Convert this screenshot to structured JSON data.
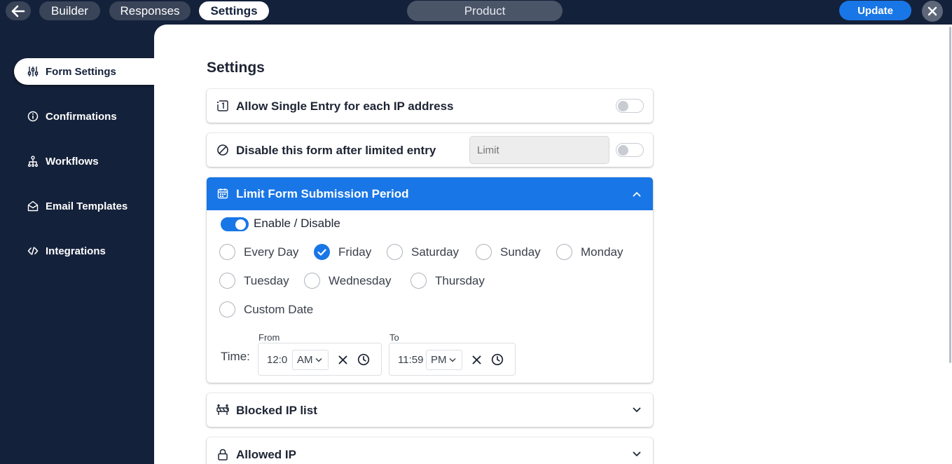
{
  "topbar": {
    "tabs": [
      {
        "label": "Builder",
        "active": false
      },
      {
        "label": "Responses",
        "active": false
      },
      {
        "label": "Settings",
        "active": true
      }
    ],
    "form_name": "Product",
    "update_label": "Update"
  },
  "sidebar": {
    "items": [
      {
        "label": "Form Settings",
        "icon": "sliders-icon",
        "active": true
      },
      {
        "label": "Confirmations",
        "icon": "info-icon",
        "active": false
      },
      {
        "label": "Workflows",
        "icon": "hierarchy-icon",
        "active": false
      },
      {
        "label": "Email Templates",
        "icon": "envelope-open-icon",
        "active": false
      },
      {
        "label": "Integrations",
        "icon": "code-icon",
        "active": false
      }
    ]
  },
  "main": {
    "title": "Settings",
    "single_entry": {
      "label": "Allow Single Entry for each IP address",
      "enabled": false
    },
    "limited_entry": {
      "label": "Disable this form after limited entry",
      "placeholder": "Limit",
      "enabled": false
    },
    "period": {
      "label": "Limit Form Submission Period",
      "expanded": true,
      "enable_label": "Enable / Disable",
      "enabled": true,
      "days": [
        {
          "label": "Every Day",
          "checked": false
        },
        {
          "label": "Friday",
          "checked": true
        },
        {
          "label": "Saturday",
          "checked": false
        },
        {
          "label": "Sunday",
          "checked": false
        },
        {
          "label": "Monday",
          "checked": false
        },
        {
          "label": "Tuesday",
          "checked": false
        },
        {
          "label": "Wednesday",
          "checked": false
        },
        {
          "label": "Thursday",
          "checked": false
        },
        {
          "label": "Custom Date",
          "checked": false
        }
      ],
      "time_label": "Time:",
      "from": {
        "label": "From",
        "value": "12:0",
        "meridiem": "AM"
      },
      "to": {
        "label": "To",
        "value": "11:59",
        "meridiem": "PM"
      }
    },
    "blocked_ip": {
      "label": "Blocked IP list"
    },
    "allowed_ip": {
      "label": "Allowed IP"
    }
  },
  "colors": {
    "accent": "#1976e6",
    "navy": "#14213a"
  }
}
